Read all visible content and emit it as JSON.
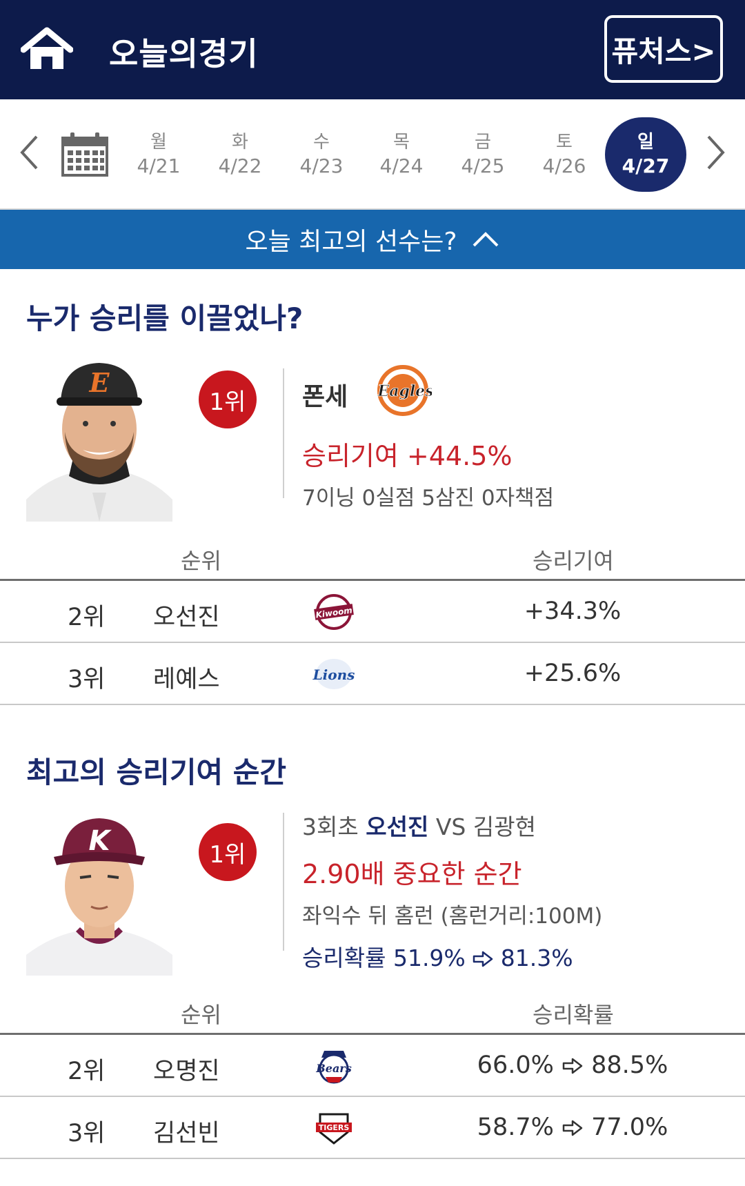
{
  "header": {
    "title": "오늘의경기",
    "futures_label": "퓨처스>",
    "home_icon": "home-icon"
  },
  "date_nav": {
    "prev_icon": "chevron-left-icon",
    "next_icon": "chevron-right-icon",
    "calendar_icon": "calendar-icon",
    "days": [
      {
        "day": "월",
        "date": "4/21"
      },
      {
        "day": "화",
        "date": "4/22"
      },
      {
        "day": "수",
        "date": "4/23"
      },
      {
        "day": "목",
        "date": "4/24"
      },
      {
        "day": "금",
        "date": "4/25"
      },
      {
        "day": "토",
        "date": "4/26"
      },
      {
        "day": "일",
        "date": "4/27"
      }
    ],
    "selected_index": 6
  },
  "banner": {
    "label": "오늘 최고의 선수는?",
    "icon": "chevron-up-icon"
  },
  "win_leader": {
    "title": "누가 승리를 이끌었나?",
    "top": {
      "rank": "1위",
      "name": "폰세",
      "team_logo": "Eagles",
      "contribution": "승리기여 +44.5%",
      "stats": "7이닝 0실점 5삼진 0자책점"
    },
    "table": {
      "col_rank": "순위",
      "col_value": "승리기여",
      "rows": [
        {
          "rank": "2위",
          "name": "오선진",
          "logo": "Kiwoom",
          "value": "+34.3%"
        },
        {
          "rank": "3위",
          "name": "레예스",
          "logo": "Lions",
          "value": "+25.6%"
        }
      ]
    }
  },
  "best_moment": {
    "title": "최고의 승리기여 순간",
    "top": {
      "rank": "1위",
      "inning": "3회초",
      "batter": "오선진",
      "vs": "VS",
      "pitcher": "김광현",
      "importance": "2.90배 중요한 순간",
      "play": "좌익수 뒤 홈런 (홈런거리:100M)",
      "win_prob_label": "승리확률",
      "win_prob_from": "51.9%",
      "win_prob_to": "81.3%"
    },
    "table": {
      "col_rank": "순위",
      "col_value": "승리확률",
      "rows": [
        {
          "rank": "2위",
          "name": "오명진",
          "logo": "Bears",
          "from": "66.0%",
          "to": "88.5%"
        },
        {
          "rank": "3위",
          "name": "김선빈",
          "logo": "TIGERS",
          "from": "58.7%",
          "to": "77.0%"
        }
      ]
    }
  },
  "colors": {
    "header_bg": "#0d1b4b",
    "banner_bg": "#1766ad",
    "accent_red": "#c8171e",
    "navy": "#1a2a6c"
  }
}
